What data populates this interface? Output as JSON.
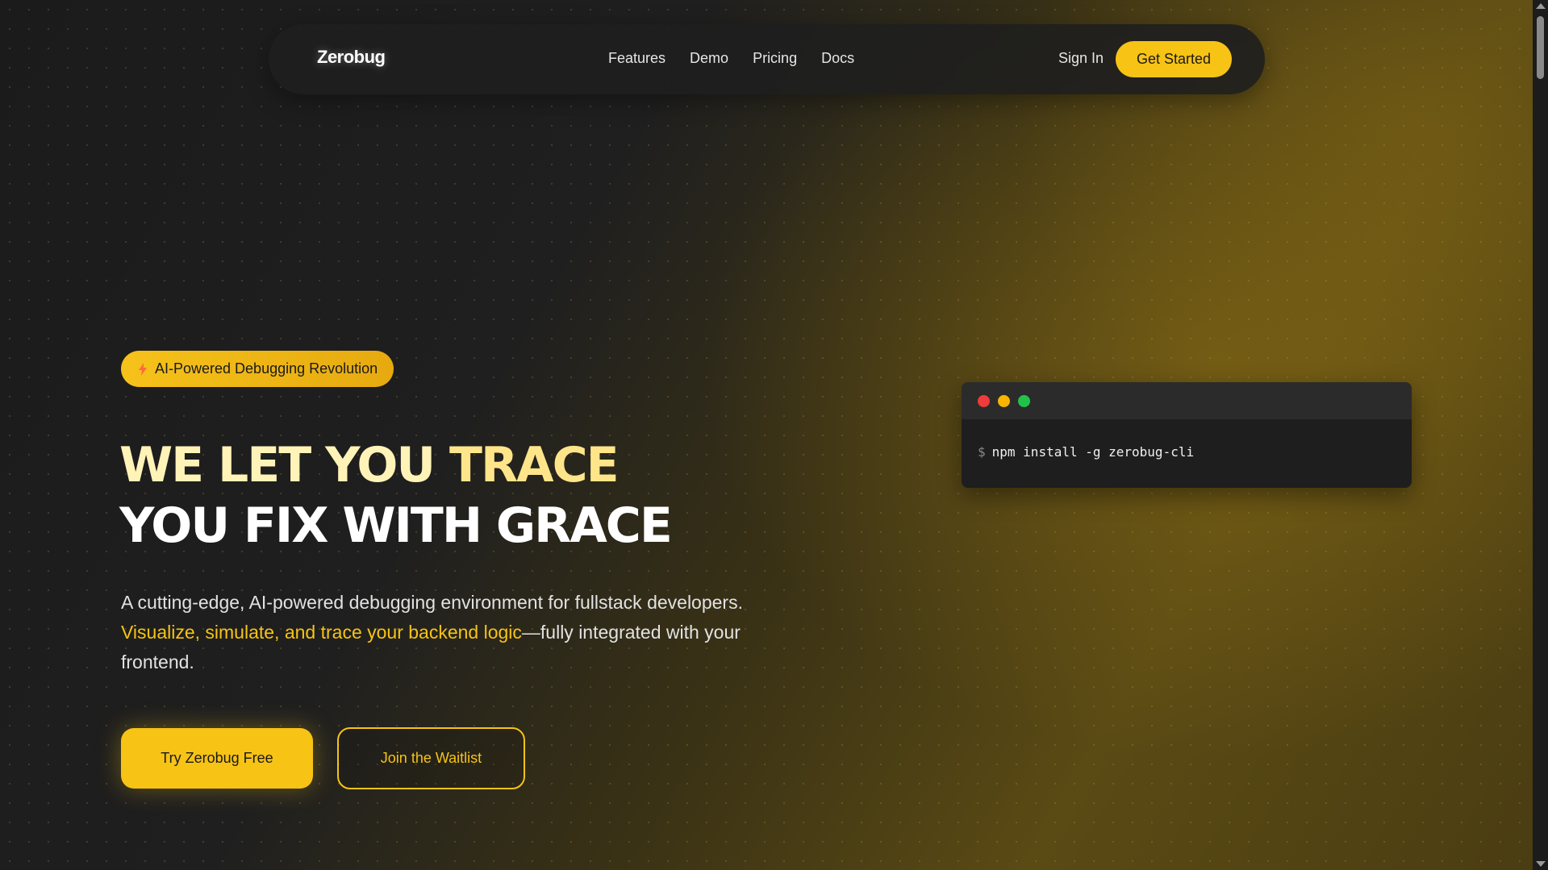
{
  "nav": {
    "logo": "Zerobug",
    "links": [
      "Features",
      "Demo",
      "Pricing",
      "Docs"
    ],
    "sign_in": "Sign In",
    "get_started": "Get Started"
  },
  "hero": {
    "badge": "AI-Powered Debugging Revolution",
    "headline_line1_a": "WE LET YOU ",
    "headline_line1_b": "TRACE",
    "headline_line2": "YOU FIX WITH GRACE",
    "subtitle_a": "A cutting-edge, AI-powered debugging environment for fullstack developers.",
    "subtitle_highlight": "Visualize, simulate, and trace your backend logic",
    "subtitle_b": "—fully integrated with your frontend.",
    "primary_cta": "Try Zerobug Free",
    "secondary_cta": "Join the Waitlist"
  },
  "terminal": {
    "prompt": "$",
    "command": "npm install -g zerobug-cli"
  },
  "colors": {
    "accent": "#f7c315",
    "background": "#1a1a1a"
  }
}
